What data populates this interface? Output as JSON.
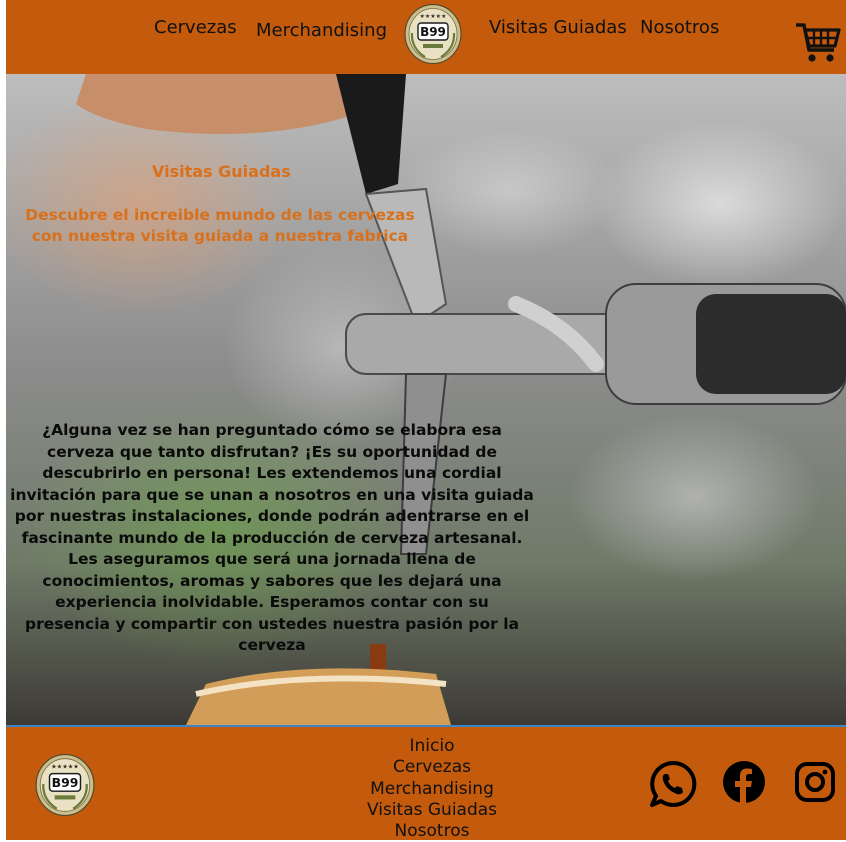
{
  "header": {
    "nav_left": [
      "Cervezas",
      "Merchandising"
    ],
    "nav_right": [
      "Visitas Guiadas",
      "Nosotros"
    ],
    "logo_text": "B99",
    "cart_icon": "shopping-cart-icon"
  },
  "hero": {
    "title": "Visitas Guiadas",
    "subtitle": "Descubre el increible mundo de las cervezas con nuestra visita guiada a nuestra fabrica",
    "body": "¿Alguna vez se han preguntado cómo se elabora esa cerveza que tanto disfrutan? ¡Es su oportunidad de descubrirlo en persona! Les extendemos una cordial invitación para que se unan a nosotros en una visita guiada por nuestras instalaciones, donde podrán adentrarse en el fascinante mundo de la producción de cerveza artesanal. Les aseguramos que será una jornada llena de conocimientos, aromas y sabores que les dejará una experiencia inolvidable. Esperamos contar con su presencia y compartir con ustedes nuestra pasión por la cerveza"
  },
  "footer": {
    "logo_text": "B99",
    "links": [
      "Inicio",
      "Cervezas",
      "Merchandising",
      "Visitas Guiadas",
      "Nosotros"
    ],
    "social": [
      "whatsapp-icon",
      "facebook-icon",
      "instagram-icon"
    ]
  },
  "colors": {
    "brand_orange": "#c35a0c",
    "accent_orange": "#d8701c",
    "footer_border": "#3a86c8"
  }
}
